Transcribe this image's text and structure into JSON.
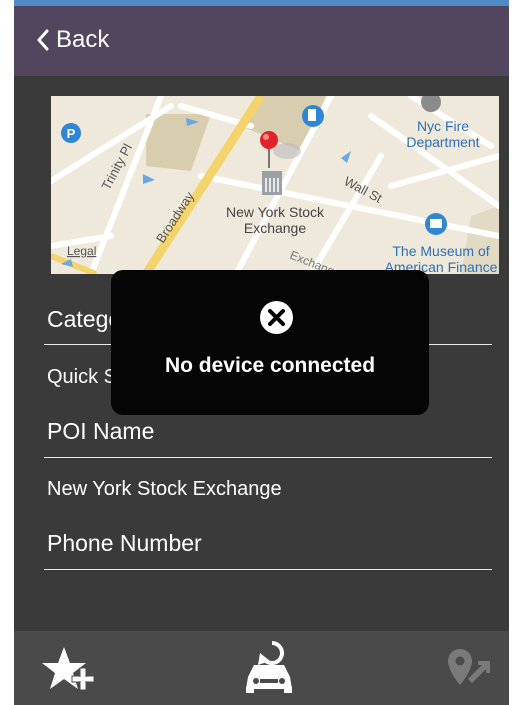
{
  "nav": {
    "back_label": "Back"
  },
  "map": {
    "labels": {
      "trinity_pl": "Trinity Pl",
      "broadway": "Broadway",
      "wall_st": "Wall St",
      "exchange_st": "Exchange",
      "nyse_line1": "New York Stock",
      "nyse_line2": "Exchange",
      "fire_line1": "Nyc Fire",
      "fire_line2": "Department",
      "museum_line1": "The Museum of",
      "museum_line2": "American Finance",
      "legal": "Legal",
      "pin_icon": "red-pin",
      "parking": "P"
    }
  },
  "form": {
    "category_label": "Category",
    "category_value": "Quick Spot",
    "poi_label": "POI Name",
    "poi_value": "New York Stock Exchange",
    "phone_label": "Phone Number"
  },
  "toast": {
    "message": "No device connected",
    "icon": "close-circle-icon"
  },
  "tabbar": {
    "icons": [
      "star-add-icon",
      "car-download-icon",
      "location-send-icon"
    ]
  },
  "colors": {
    "navbar": "#52465e",
    "background": "#3a3a3a",
    "tabbar": "#4a4a4a",
    "pin": "#e2222a",
    "accent": "#4f8bc7"
  }
}
